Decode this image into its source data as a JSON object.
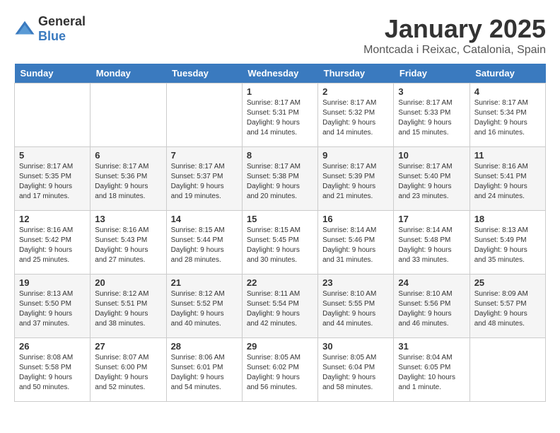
{
  "header": {
    "logo_general": "General",
    "logo_blue": "Blue",
    "month": "January 2025",
    "location": "Montcada i Reixac, Catalonia, Spain"
  },
  "weekdays": [
    "Sunday",
    "Monday",
    "Tuesday",
    "Wednesday",
    "Thursday",
    "Friday",
    "Saturday"
  ],
  "weeks": [
    [
      {
        "day": "",
        "info": ""
      },
      {
        "day": "",
        "info": ""
      },
      {
        "day": "",
        "info": ""
      },
      {
        "day": "1",
        "info": "Sunrise: 8:17 AM\nSunset: 5:31 PM\nDaylight: 9 hours\nand 14 minutes."
      },
      {
        "day": "2",
        "info": "Sunrise: 8:17 AM\nSunset: 5:32 PM\nDaylight: 9 hours\nand 14 minutes."
      },
      {
        "day": "3",
        "info": "Sunrise: 8:17 AM\nSunset: 5:33 PM\nDaylight: 9 hours\nand 15 minutes."
      },
      {
        "day": "4",
        "info": "Sunrise: 8:17 AM\nSunset: 5:34 PM\nDaylight: 9 hours\nand 16 minutes."
      }
    ],
    [
      {
        "day": "5",
        "info": "Sunrise: 8:17 AM\nSunset: 5:35 PM\nDaylight: 9 hours\nand 17 minutes."
      },
      {
        "day": "6",
        "info": "Sunrise: 8:17 AM\nSunset: 5:36 PM\nDaylight: 9 hours\nand 18 minutes."
      },
      {
        "day": "7",
        "info": "Sunrise: 8:17 AM\nSunset: 5:37 PM\nDaylight: 9 hours\nand 19 minutes."
      },
      {
        "day": "8",
        "info": "Sunrise: 8:17 AM\nSunset: 5:38 PM\nDaylight: 9 hours\nand 20 minutes."
      },
      {
        "day": "9",
        "info": "Sunrise: 8:17 AM\nSunset: 5:39 PM\nDaylight: 9 hours\nand 21 minutes."
      },
      {
        "day": "10",
        "info": "Sunrise: 8:17 AM\nSunset: 5:40 PM\nDaylight: 9 hours\nand 23 minutes."
      },
      {
        "day": "11",
        "info": "Sunrise: 8:16 AM\nSunset: 5:41 PM\nDaylight: 9 hours\nand 24 minutes."
      }
    ],
    [
      {
        "day": "12",
        "info": "Sunrise: 8:16 AM\nSunset: 5:42 PM\nDaylight: 9 hours\nand 25 minutes."
      },
      {
        "day": "13",
        "info": "Sunrise: 8:16 AM\nSunset: 5:43 PM\nDaylight: 9 hours\nand 27 minutes."
      },
      {
        "day": "14",
        "info": "Sunrise: 8:15 AM\nSunset: 5:44 PM\nDaylight: 9 hours\nand 28 minutes."
      },
      {
        "day": "15",
        "info": "Sunrise: 8:15 AM\nSunset: 5:45 PM\nDaylight: 9 hours\nand 30 minutes."
      },
      {
        "day": "16",
        "info": "Sunrise: 8:14 AM\nSunset: 5:46 PM\nDaylight: 9 hours\nand 31 minutes."
      },
      {
        "day": "17",
        "info": "Sunrise: 8:14 AM\nSunset: 5:48 PM\nDaylight: 9 hours\nand 33 minutes."
      },
      {
        "day": "18",
        "info": "Sunrise: 8:13 AM\nSunset: 5:49 PM\nDaylight: 9 hours\nand 35 minutes."
      }
    ],
    [
      {
        "day": "19",
        "info": "Sunrise: 8:13 AM\nSunset: 5:50 PM\nDaylight: 9 hours\nand 37 minutes."
      },
      {
        "day": "20",
        "info": "Sunrise: 8:12 AM\nSunset: 5:51 PM\nDaylight: 9 hours\nand 38 minutes."
      },
      {
        "day": "21",
        "info": "Sunrise: 8:12 AM\nSunset: 5:52 PM\nDaylight: 9 hours\nand 40 minutes."
      },
      {
        "day": "22",
        "info": "Sunrise: 8:11 AM\nSunset: 5:54 PM\nDaylight: 9 hours\nand 42 minutes."
      },
      {
        "day": "23",
        "info": "Sunrise: 8:10 AM\nSunset: 5:55 PM\nDaylight: 9 hours\nand 44 minutes."
      },
      {
        "day": "24",
        "info": "Sunrise: 8:10 AM\nSunset: 5:56 PM\nDaylight: 9 hours\nand 46 minutes."
      },
      {
        "day": "25",
        "info": "Sunrise: 8:09 AM\nSunset: 5:57 PM\nDaylight: 9 hours\nand 48 minutes."
      }
    ],
    [
      {
        "day": "26",
        "info": "Sunrise: 8:08 AM\nSunset: 5:58 PM\nDaylight: 9 hours\nand 50 minutes."
      },
      {
        "day": "27",
        "info": "Sunrise: 8:07 AM\nSunset: 6:00 PM\nDaylight: 9 hours\nand 52 minutes."
      },
      {
        "day": "28",
        "info": "Sunrise: 8:06 AM\nSunset: 6:01 PM\nDaylight: 9 hours\nand 54 minutes."
      },
      {
        "day": "29",
        "info": "Sunrise: 8:05 AM\nSunset: 6:02 PM\nDaylight: 9 hours\nand 56 minutes."
      },
      {
        "day": "30",
        "info": "Sunrise: 8:05 AM\nSunset: 6:04 PM\nDaylight: 9 hours\nand 58 minutes."
      },
      {
        "day": "31",
        "info": "Sunrise: 8:04 AM\nSunset: 6:05 PM\nDaylight: 10 hours\nand 1 minute."
      },
      {
        "day": "",
        "info": ""
      }
    ]
  ]
}
